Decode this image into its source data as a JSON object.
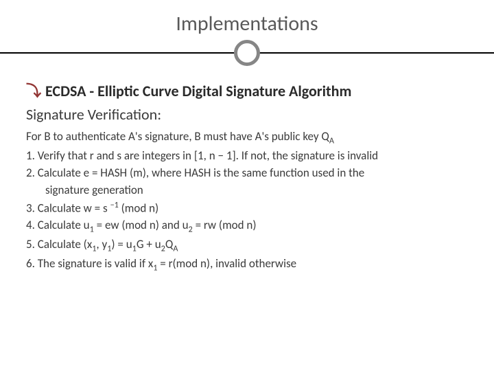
{
  "title": "Implementations",
  "bullet_glyph": "⤵",
  "subtitle": "ECDSA - Elliptic Curve Digital Signature Algorithm",
  "section": "Signature Verification:",
  "lines": {
    "l0": "For B to authenticate A's signature, B must have A's public key Q",
    "l0_sub": "A",
    "l1": "1. Verify that r and s are integers in [1, n − 1]. If not, the signature is invalid",
    "l2": "2. Calculate e = HASH (m), where HASH is the same function used in the",
    "l2b": "signature generation",
    "l3a": "3. Calculate w = s ",
    "l3sup": "−1",
    "l3b": " (mod n)",
    "l4a": "4. Calculate u",
    "l4s1": "1",
    "l4b": " = ew (mod n) and u",
    "l4s2": "2",
    "l4c": " = rw (mod n)",
    "l5a": "5. Calculate (x",
    "l5s1": "1",
    "l5b": ", y",
    "l5s2": "1",
    "l5c": ") = u",
    "l5s3": "1",
    "l5d": "G + u",
    "l5s4": "2",
    "l5e": "Q",
    "l5s5": "A",
    "l6a": "6. The signature is valid if x",
    "l6s1": "1",
    "l6b": " = r(mod n), invalid otherwise"
  }
}
